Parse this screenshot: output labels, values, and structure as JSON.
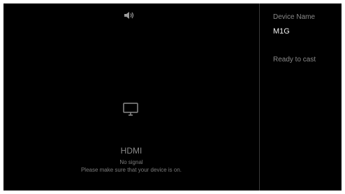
{
  "main": {
    "source_title": "HDMI",
    "status_text": "No signal",
    "hint_text": "Please make sure that your device is on.",
    "icons": {
      "volume": "volume-icon",
      "monitor": "monitor-icon"
    }
  },
  "sidebar": {
    "device_label": "Device Name",
    "device_name": "M1G",
    "cast_status": "Ready to cast"
  },
  "colors": {
    "background": "#000000",
    "text_primary": "#f2f2f2",
    "text_secondary": "#8a8a8a",
    "divider": "#3a3a3a"
  }
}
